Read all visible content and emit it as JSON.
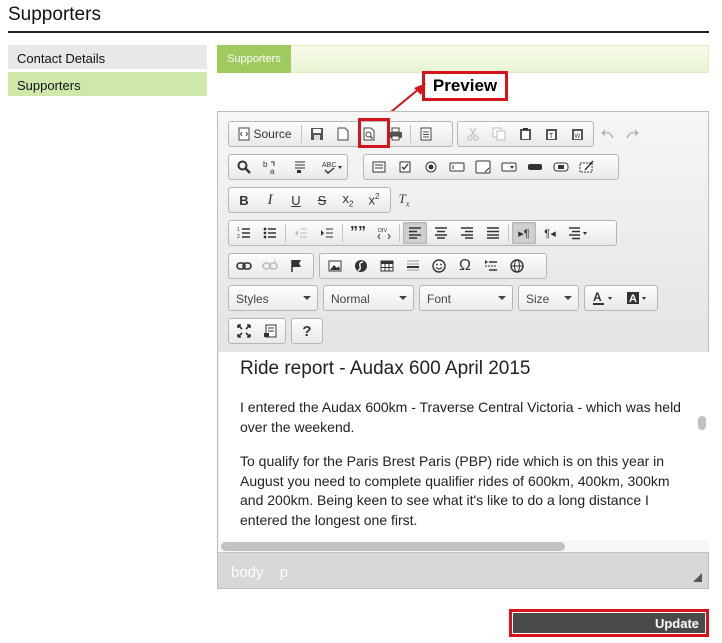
{
  "page": {
    "title": "Supporters"
  },
  "sidebar": {
    "items": [
      {
        "label": "Contact Details",
        "selected": false
      },
      {
        "label": "Supporters",
        "selected": true
      }
    ]
  },
  "tabs": [
    {
      "label": "Supporters",
      "active": true
    }
  ],
  "callout": {
    "label": "Preview",
    "color": "#d4141a"
  },
  "toolbar": {
    "source_label": "Source",
    "combos": {
      "styles": "Styles",
      "format": "Normal",
      "font": "Font",
      "size": "Size"
    }
  },
  "document": {
    "heading": "Ride report - Audax 600 April 2015",
    "paragraphs": [
      "I entered the Audax 600km - Traverse Central Victoria - which was held over the weekend.",
      "To qualify for the Paris Brest Paris (PBP) ride which is on this year in August you need to complete qualifier rides of 600km, 400km, 300km and 200km.  Being keen to see what it's like to do a long distance I entered the longest one first."
    ]
  },
  "statusbar": {
    "path": [
      "body",
      "p"
    ]
  },
  "actions": {
    "update_label": "Update"
  },
  "colors": {
    "accent_green": "#9fcb5e",
    "selected_side": "#cfe7a9",
    "highlight_red": "#d4141a",
    "button_dark": "#4a4a4a"
  }
}
